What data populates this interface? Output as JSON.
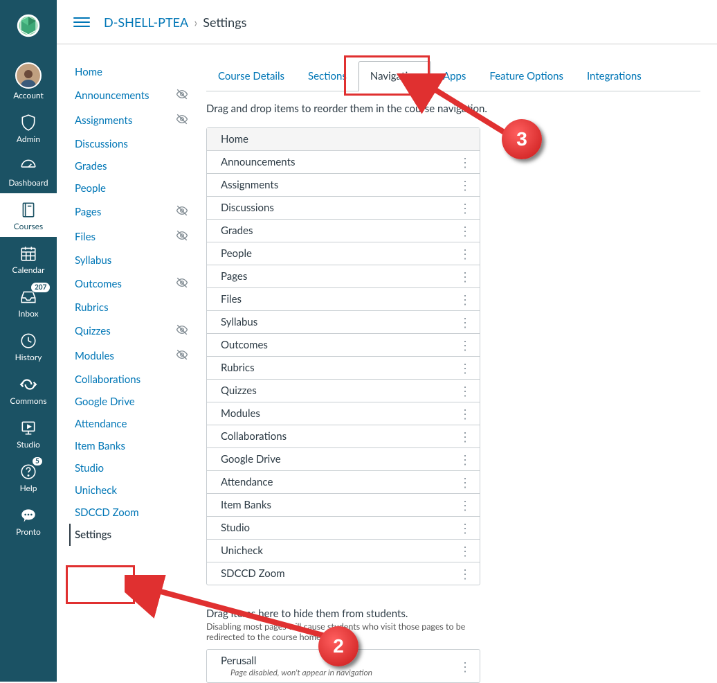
{
  "global_nav": {
    "items": [
      {
        "label": "Account"
      },
      {
        "label": "Admin"
      },
      {
        "label": "Dashboard"
      },
      {
        "label": "Courses"
      },
      {
        "label": "Calendar"
      },
      {
        "label": "Inbox",
        "badge": "207"
      },
      {
        "label": "History"
      },
      {
        "label": "Commons"
      },
      {
        "label": "Studio"
      },
      {
        "label": "Help",
        "badge": "5"
      },
      {
        "label": "Pronto"
      }
    ]
  },
  "breadcrumb": {
    "course": "D-SHELL-PTEA",
    "current": "Settings"
  },
  "course_nav": {
    "items": [
      {
        "label": "Home"
      },
      {
        "label": "Announcements",
        "hidden": true
      },
      {
        "label": "Assignments",
        "hidden": true
      },
      {
        "label": "Discussions"
      },
      {
        "label": "Grades"
      },
      {
        "label": "People"
      },
      {
        "label": "Pages",
        "hidden": true
      },
      {
        "label": "Files",
        "hidden": true
      },
      {
        "label": "Syllabus"
      },
      {
        "label": "Outcomes",
        "hidden": true
      },
      {
        "label": "Rubrics"
      },
      {
        "label": "Quizzes",
        "hidden": true
      },
      {
        "label": "Modules",
        "hidden": true
      },
      {
        "label": "Collaborations"
      },
      {
        "label": "Google Drive"
      },
      {
        "label": "Attendance"
      },
      {
        "label": "Item Banks"
      },
      {
        "label": "Studio"
      },
      {
        "label": "Unicheck"
      },
      {
        "label": "SDCCD Zoom"
      },
      {
        "label": "Settings",
        "active": true
      }
    ]
  },
  "tabs": [
    {
      "label": "Course Details"
    },
    {
      "label": "Sections"
    },
    {
      "label": "Navigation",
      "active": true
    },
    {
      "label": "Apps"
    },
    {
      "label": "Feature Options"
    },
    {
      "label": "Integrations"
    }
  ],
  "instructions": "Drag and drop items to reorder them in the course navigation.",
  "nav_items": [
    "Home",
    "Announcements",
    "Assignments",
    "Discussions",
    "Grades",
    "People",
    "Pages",
    "Files",
    "Syllabus",
    "Outcomes",
    "Rubrics",
    "Quizzes",
    "Modules",
    "Collaborations",
    "Google Drive",
    "Attendance",
    "Item Banks",
    "Studio",
    "Unicheck",
    "SDCCD Zoom"
  ],
  "hide_section": {
    "title": "Drag items here to hide them from students.",
    "sub": "Disabling most pages will cause students who visit those pages to be redirected to the course home page.",
    "items": [
      {
        "label": "Perusall",
        "sub": "Page disabled, won't appear in navigation"
      }
    ]
  },
  "annotations": {
    "circle3": "3",
    "circle2": "2"
  }
}
